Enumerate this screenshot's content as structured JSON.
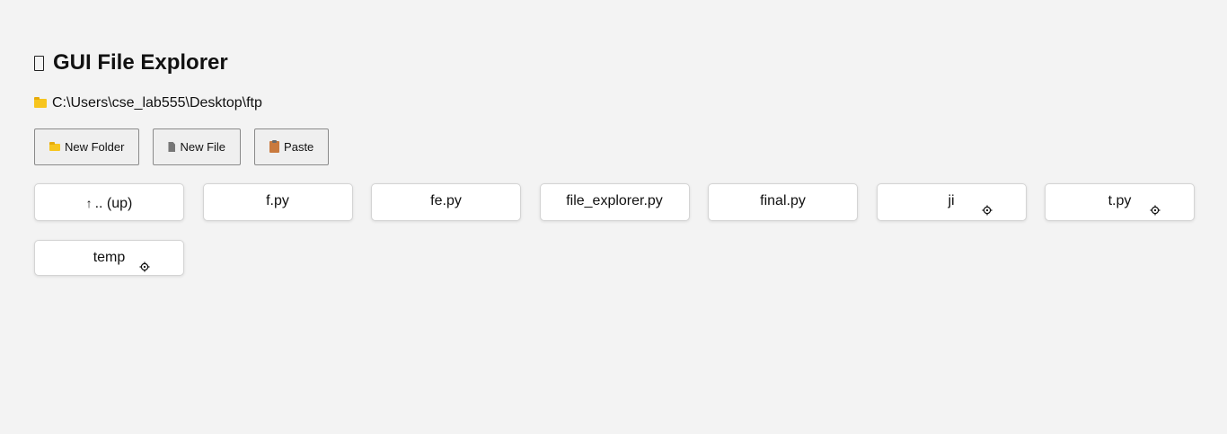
{
  "header": {
    "title": "GUI File Explorer"
  },
  "path_bar": {
    "path": "C:\\Users\\cse_lab555\\Desktop\\ftp",
    "icon": "folder-icon"
  },
  "toolbar": {
    "new_folder_label": "New Folder",
    "new_file_label": "New File",
    "paste_label": "Paste"
  },
  "entries": [
    {
      "label": ".. (up)",
      "kind": "parent",
      "icon": "up-arrow-icon"
    },
    {
      "label": "f.py",
      "kind": "file"
    },
    {
      "label": "fe.py",
      "kind": "file"
    },
    {
      "label": "file_explorer.py",
      "kind": "file"
    },
    {
      "label": "final.py",
      "kind": "file"
    },
    {
      "label": "ji",
      "kind": "folder",
      "icon": "gear-icon"
    },
    {
      "label": "t.py",
      "kind": "file",
      "icon": "gear-icon"
    },
    {
      "label": "temp",
      "kind": "folder",
      "icon": "gear-icon"
    }
  ],
  "colors": {
    "background": "#f3f3f3",
    "folder_icon": "#f7c51e",
    "file_icon": "#777777",
    "clipboard_icon": "#c97a3e"
  }
}
